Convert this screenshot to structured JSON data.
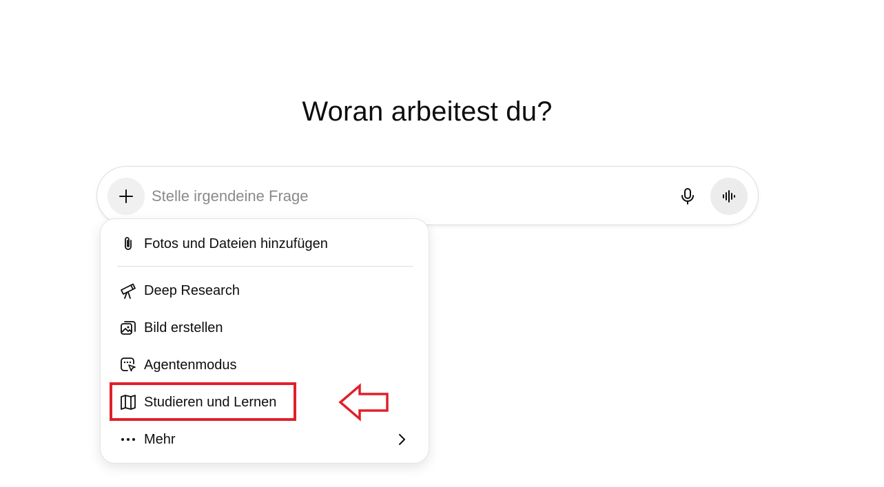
{
  "headline": "Woran arbeitest du?",
  "composer": {
    "placeholder": "Stelle irgendeine Frage",
    "value": "",
    "plus_icon": "plus-icon",
    "mic_icon": "microphone-icon",
    "voice_icon": "voice-waveform-icon"
  },
  "menu": {
    "items": [
      {
        "label": "Fotos und Dateien hinzufügen",
        "icon": "paperclip-icon"
      },
      {
        "label": "Deep Research",
        "icon": "telescope-icon"
      },
      {
        "label": "Bild erstellen",
        "icon": "image-icon"
      },
      {
        "label": "Agentenmodus",
        "icon": "agent-cursor-icon"
      },
      {
        "label": "Studieren und Lernen",
        "icon": "book-icon"
      },
      {
        "label": "Mehr",
        "icon": "more-dots-icon",
        "chevron": "chevron-right-icon"
      }
    ]
  },
  "annotation": {
    "color": "#e0202a",
    "target": "Studieren und Lernen"
  }
}
